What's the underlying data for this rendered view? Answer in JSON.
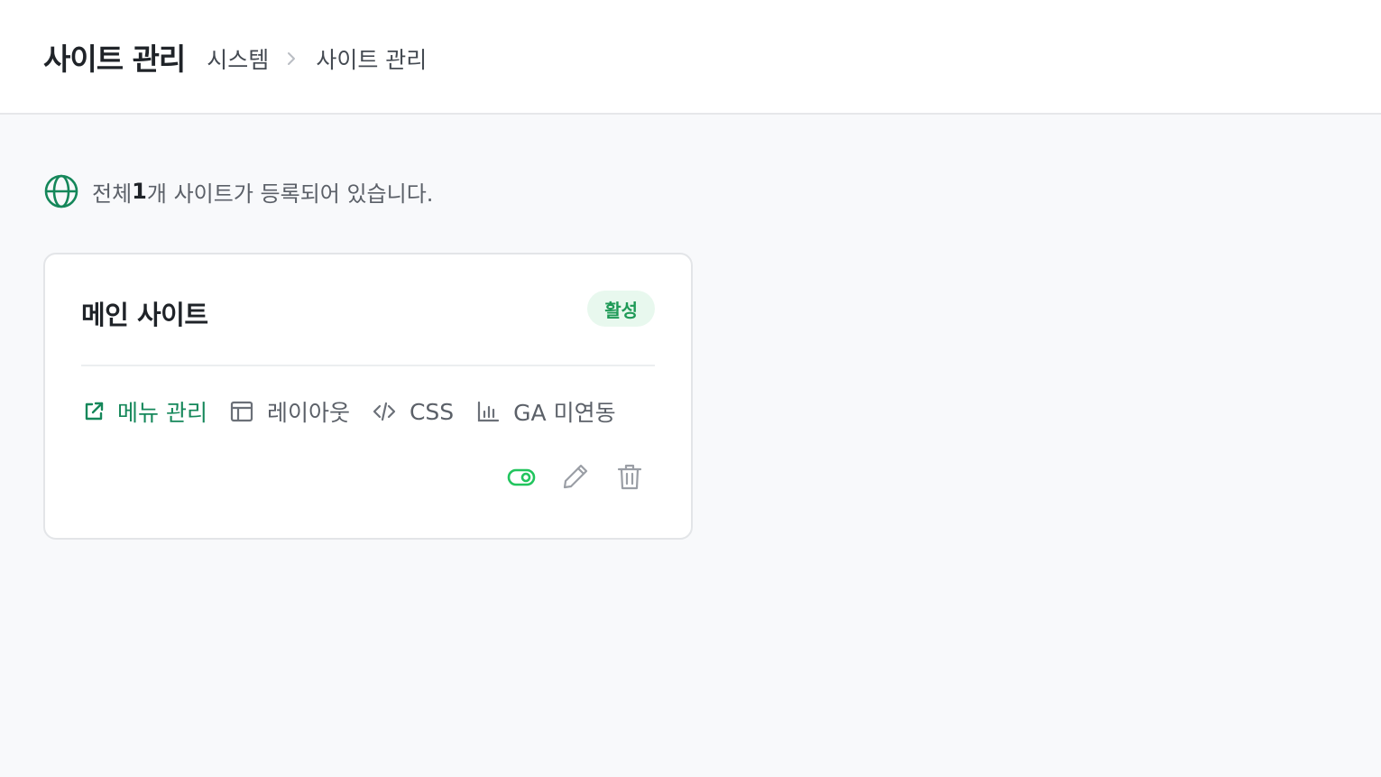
{
  "header": {
    "title": "사이트 관리",
    "breadcrumb": [
      "시스템",
      "사이트 관리"
    ]
  },
  "summary": {
    "prefix": "전체 ",
    "count": "1",
    "suffix": "개 사이트가 등록되어 있습니다."
  },
  "sites": [
    {
      "name": "메인 사이트",
      "status": "활성",
      "links": {
        "menu": "메뉴 관리",
        "layout": "레이아웃",
        "css": "CSS",
        "ga": "GA 미연동"
      }
    }
  ],
  "colors": {
    "accent": "#15875a",
    "toggle_on": "#22c55e",
    "badge_bg": "#e8f8ee",
    "badge_text": "#1f9a57",
    "muted_icon": "#9a9ea5"
  },
  "icons": {
    "summary": "globe-icon",
    "breadcrumb_separator": "chevron-right-icon",
    "menu": "external-link-icon",
    "layout": "layout-icon",
    "css": "code-icon",
    "ga": "bar-chart-icon",
    "toggle": "toggle-on-icon",
    "edit": "pencil-icon",
    "delete": "trash-icon"
  }
}
